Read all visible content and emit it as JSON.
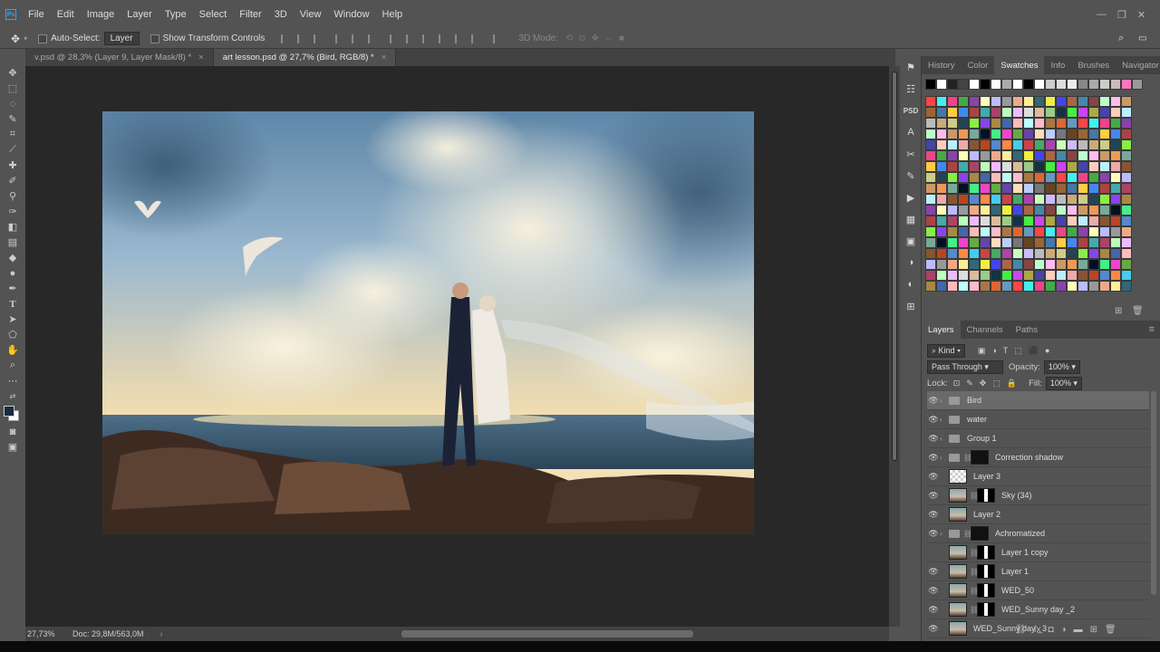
{
  "menu": {
    "logo": "Ps",
    "items": [
      "File",
      "Edit",
      "Image",
      "Layer",
      "Type",
      "Select",
      "Filter",
      "3D",
      "View",
      "Window",
      "Help"
    ]
  },
  "options": {
    "auto_select_label": "Auto-Select:",
    "auto_select_value": "Layer",
    "show_transform_label": "Show Transform Controls",
    "mode_3d_label": "3D Mode:"
  },
  "doc_tabs": [
    {
      "label": "v.psd @ 28,3% (Layer 9, Layer Mask/8) *",
      "active": false
    },
    {
      "label": "art lesson.psd @ 27,7% (Bird, RGB/8) *",
      "active": true
    }
  ],
  "status": {
    "zoom": "27,73%",
    "doc": "Doc: 29,8M/563,0M"
  },
  "swatch_tabs": [
    "History",
    "Color",
    "Swatches",
    "Info",
    "Brushes",
    "Navigator"
  ],
  "active_swatch_tab": "Swatches",
  "layers_tabs": [
    "Layers",
    "Channels",
    "Paths"
  ],
  "active_layers_tab": "Layers",
  "layers": {
    "filter": "Kind",
    "blend_mode": "Pass Through",
    "opacity_label": "Opacity:",
    "opacity": "100%",
    "lock_label": "Lock:",
    "fill_label": "Fill:",
    "fill": "100%",
    "items": [
      {
        "name": "Bird",
        "type": "group",
        "visible": true,
        "selected": true
      },
      {
        "name": "water",
        "type": "group",
        "visible": true
      },
      {
        "name": "Group 1",
        "type": "group",
        "visible": true
      },
      {
        "name": "Correction shadow",
        "type": "group-mask",
        "visible": true
      },
      {
        "name": "Layer 3",
        "type": "transparent",
        "visible": true
      },
      {
        "name": "Sky (34)",
        "type": "image-mask",
        "visible": true
      },
      {
        "name": "Layer 2",
        "type": "image",
        "visible": true
      },
      {
        "name": "Achromatized",
        "type": "group-mask",
        "visible": true
      },
      {
        "name": "Layer 1 copy",
        "type": "image-mask",
        "visible": false
      },
      {
        "name": "Layer 1",
        "type": "image-mask",
        "visible": true
      },
      {
        "name": "WED_50",
        "type": "image-mask",
        "visible": true
      },
      {
        "name": "WED_Sunny day _2",
        "type": "image-mask",
        "visible": true
      },
      {
        "name": "WED_Sunny day _3",
        "type": "image",
        "visible": true
      }
    ]
  },
  "colors": {
    "accent": "#2fa3f6",
    "canvas": "#282828",
    "panel": "#535353"
  }
}
